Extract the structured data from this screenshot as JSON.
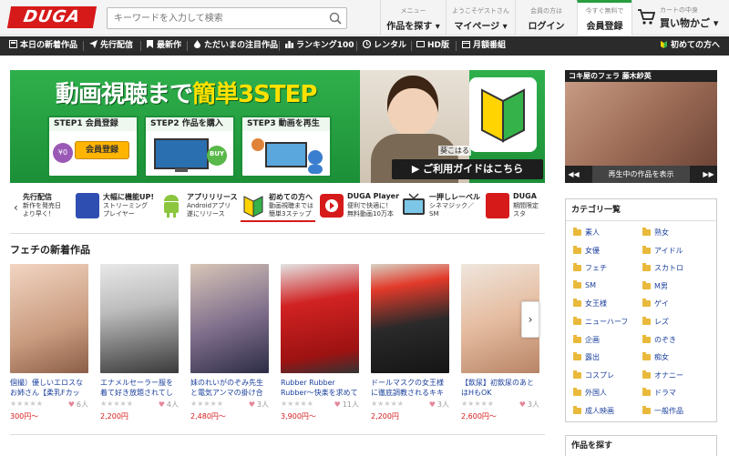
{
  "header": {
    "logo": "DUGA",
    "search": {
      "placeholder": "キーワードを入力して検索"
    },
    "nav": [
      {
        "small": "メニュー",
        "big": "作品を探す ▾"
      },
      {
        "small": "ようこそゲストさん",
        "big": "マイページ ▾"
      },
      {
        "small": "会員の方は",
        "big": "ログイン"
      },
      {
        "small": "今すぐ無料で",
        "big": "会員登録"
      }
    ],
    "cart": {
      "small": "カートの中身",
      "big": "買い物かご ▾"
    }
  },
  "menubar": {
    "items": [
      {
        "label": "本日の新着作品",
        "icon": "new-icon"
      },
      {
        "label": "先行配信",
        "icon": "send-icon"
      },
      {
        "label": "最新作",
        "icon": "bookmark-icon"
      },
      {
        "label": "ただいまの注目作品",
        "icon": "fire-icon"
      },
      {
        "label": "ランキング100",
        "icon": "ranking-icon"
      },
      {
        "label": "レンタル",
        "icon": "clock-icon"
      },
      {
        "label": "HD版",
        "icon": "hd-icon"
      },
      {
        "label": "月額番組",
        "icon": "calendar-icon"
      }
    ],
    "first_time": "初めての方へ"
  },
  "banner": {
    "title_a": "動画視聴まで",
    "title_b": "簡単",
    "title_c": "3STEP",
    "steps": [
      {
        "label": "STEP1 会員登録",
        "button": "会員登録",
        "badge": "¥0"
      },
      {
        "label": "STEP2 作品を購入",
        "badge": "BUY"
      },
      {
        "label": "STEP3 動画を再生"
      }
    ],
    "model_name": "葵こはる",
    "guide": "▶ ご利用ガイドはこちら"
  },
  "promos": [
    {
      "title": "先行配信",
      "desc": "新作を発売日\nより早く！"
    },
    {
      "title": "大幅に機能UP!",
      "desc": "ストリーミング\nプレイヤー"
    },
    {
      "title": "アプリリリース",
      "desc": "Androidアプリ\n遂にリリース"
    },
    {
      "title": "初めての方へ",
      "desc": "動画視聴までは\n簡単3ステップ"
    },
    {
      "title": "DUGA Player",
      "desc": "便利で快適に！\n無料動画10万本"
    },
    {
      "title": "一押しレーベル",
      "desc": "シネマジック／\nSM"
    },
    {
      "title": "DUGA",
      "desc": "期間限定\nスタ"
    }
  ],
  "section": {
    "title": "フェチの新着作品"
  },
  "products": [
    {
      "title": "個撮）優しいエロスなお姉さん【柔乳Fカッ",
      "likes": "6人",
      "price": "300円〜"
    },
    {
      "title": "エナメルセーラー服を着て好き放題されてし",
      "likes": "4人",
      "price": "2,200円"
    },
    {
      "title": "妹のれいがのぞみ先生と電気アンマの掛け合",
      "likes": "3人",
      "price": "2,480円〜"
    },
    {
      "title": "Rubber Rubber Rubber〜快楽を求めてき",
      "likes": "11人",
      "price": "3,900円〜"
    },
    {
      "title": "ドールマスクの女王様に徹底調教されるキキ",
      "likes": "3人",
      "price": "2,200円"
    },
    {
      "title": "【飲尿】初飲尿のあとはHもOK",
      "likes": "3人",
      "price": "2,600円〜"
    }
  ],
  "sample": {
    "label": "コキ屋のフェラ 藤木紗英",
    "play": "再生中の作品を表示"
  },
  "categories": {
    "title": "カテゴリ一覧",
    "left": [
      "素人",
      "女優",
      "フェチ",
      "SM",
      "女王様",
      "ニューハーフ",
      "企画",
      "露出",
      "コスプレ",
      "外国人",
      "成人映画"
    ],
    "right": [
      "熟女",
      "アイドル",
      "スカトロ",
      "M男",
      "ゲイ",
      "レズ",
      "のぞき",
      "痴女",
      "オナニー",
      "ドラマ",
      "一般作品"
    ]
  },
  "find": {
    "title": "作品を探す"
  },
  "colors": {
    "brand": "#d61a1a",
    "link": "#1a3f9c",
    "banner": "#1c8f37"
  }
}
